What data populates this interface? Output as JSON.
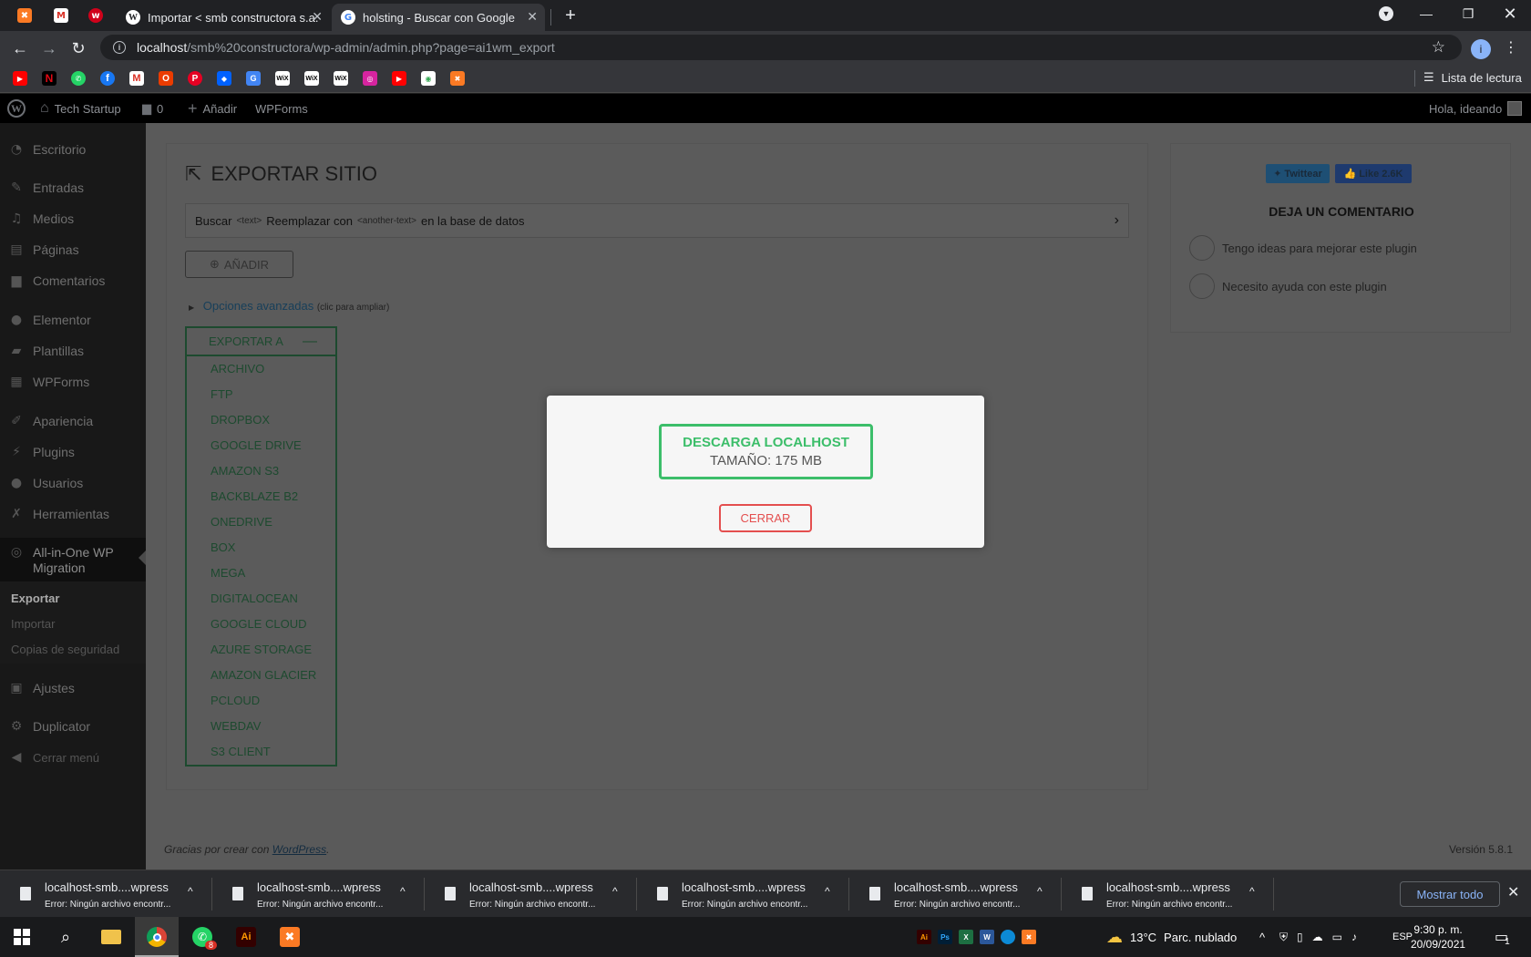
{
  "browser": {
    "tabs": [
      {
        "title": "Importar < smb constructora s.a.",
        "icon": "wordpress-icon"
      },
      {
        "title": "holsting - Buscar con Google",
        "icon": "google-icon"
      }
    ],
    "url_host": "localhost",
    "url_path": "/smb%20constructora/wp-admin/admin.php?page=ai1wm_export",
    "profile_initial": "i",
    "reading_list": "Lista de lectura",
    "bookmarks": [
      "youtube",
      "netflix",
      "whatsapp",
      "facebook",
      "gmail",
      "office",
      "pinterest",
      "dropbox",
      "translate",
      "wix",
      "wix",
      "wix",
      "instagram",
      "youtube",
      "cloud",
      "xampp"
    ],
    "bookmark_labels": {
      "wix": "WiX"
    }
  },
  "adminbar": {
    "site": "Tech Startup",
    "comments": "0",
    "add": "Añadir",
    "wpforms": "WPForms",
    "greeting": "Hola, ideando"
  },
  "sidebar": {
    "items": [
      {
        "label": "Escritorio"
      },
      {
        "label": "Entradas"
      },
      {
        "label": "Medios"
      },
      {
        "label": "Páginas"
      },
      {
        "label": "Comentarios"
      },
      {
        "label": "Elementor"
      },
      {
        "label": "Plantillas"
      },
      {
        "label": "WPForms"
      },
      {
        "label": "Apariencia"
      },
      {
        "label": "Plugins"
      },
      {
        "label": "Usuarios"
      },
      {
        "label": "Herramientas"
      },
      {
        "label": "All-in-One WP Migration"
      },
      {
        "label": "Ajustes"
      },
      {
        "label": "Duplicator"
      },
      {
        "label": "Cerrar menú"
      }
    ],
    "submenu": [
      "Exportar",
      "Importar",
      "Copias de seguridad"
    ]
  },
  "main": {
    "title": "EXPORTAR SITIO",
    "find": "Buscar",
    "find_tag": "<text>",
    "replace": "Reemplazar con",
    "replace_tag": "<another-text>",
    "db_suffix": "en la base de datos",
    "add_button": "AÑADIR",
    "advanced": "Opciones avanzadas",
    "advanced_hint": "(clic para ampliar)",
    "export_to": "EXPORTAR A",
    "export_options": [
      "ARCHIVO",
      "FTP",
      "DROPBOX",
      "GOOGLE DRIVE",
      "AMAZON S3",
      "BACKBLAZE B2",
      "ONEDRIVE",
      "BOX",
      "MEGA",
      "DIGITALOCEAN",
      "GOOGLE CLOUD",
      "AZURE STORAGE",
      "AMAZON GLACIER",
      "PCLOUD",
      "WEBDAV",
      "S3 CLIENT"
    ]
  },
  "sidecard": {
    "tweet": "Twittear",
    "like": "Like 2.6K",
    "title": "DEJA UN COMENTARIO",
    "options": [
      "Tengo ideas para mejorar este plugin",
      "Necesito ayuda con este plugin"
    ]
  },
  "footer": {
    "thanks": "Gracias por crear con",
    "wp_link": "WordPress",
    "period": ".",
    "version": "Versión 5.8.1"
  },
  "modal": {
    "download_title": "DESCARGA LOCALHOST",
    "download_size": "TAMAÑO: 175 MB",
    "close": "CERRAR"
  },
  "downloads": {
    "items": [
      {
        "name": "localhost-smb....wpress",
        "error": "Error: Ningún archivo encontr..."
      },
      {
        "name": "localhost-smb....wpress",
        "error": "Error: Ningún archivo encontr..."
      },
      {
        "name": "localhost-smb....wpress",
        "error": "Error: Ningún archivo encontr..."
      },
      {
        "name": "localhost-smb....wpress",
        "error": "Error: Ningún archivo encontr..."
      },
      {
        "name": "localhost-smb....wpress",
        "error": "Error: Ningún archivo encontr..."
      },
      {
        "name": "localhost-smb....wpress",
        "error": "Error: Ningún archivo encontr..."
      }
    ],
    "show_all": "Mostrar todo"
  },
  "taskbar": {
    "whatsapp_badge": "8",
    "weather_temp": "13°C",
    "weather_desc": "Parc. nublado",
    "lang": "ESP",
    "time": "9:30 p. m.",
    "date": "20/09/2021",
    "notif_count": "1",
    "tray_labels": {
      "illustrator": "Ai",
      "photoshop": "Ps",
      "excel": "X",
      "word": "W"
    }
  },
  "colors": {
    "accent_green": "#3cbe6a",
    "close_red": "#e44f4f",
    "link_blue": "#8ab4f8"
  }
}
